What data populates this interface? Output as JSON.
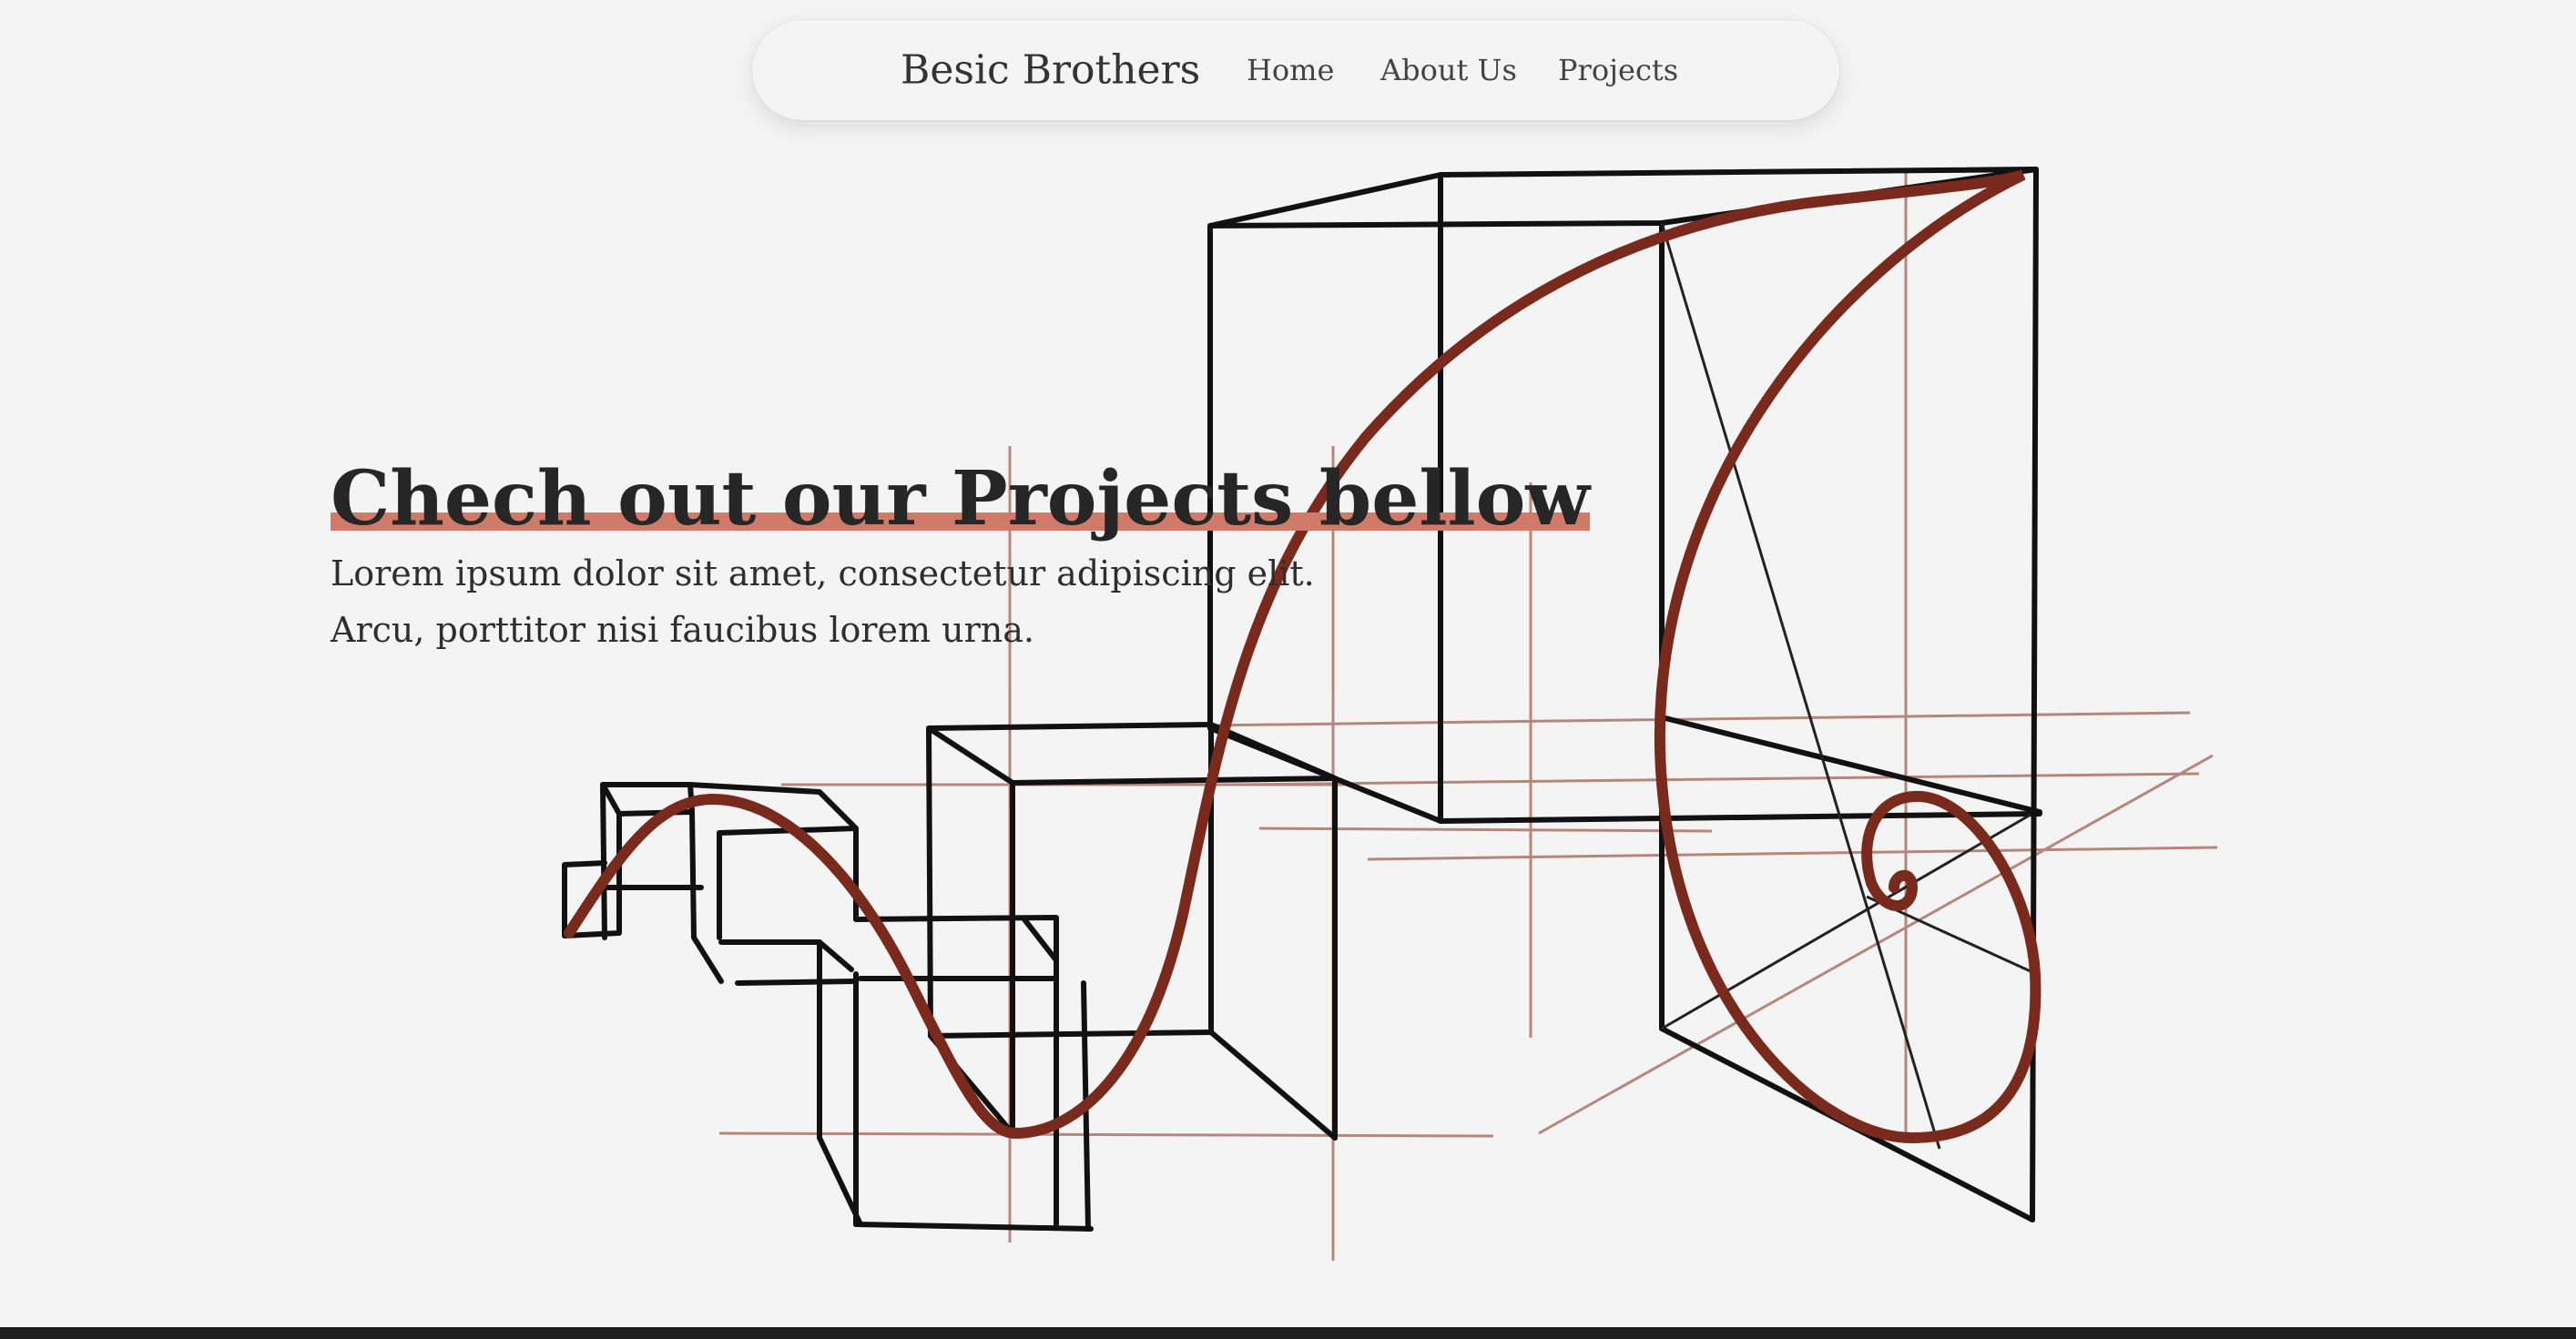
{
  "nav": {
    "brand": "Besic Brothers",
    "links": [
      "Home",
      "About Us",
      "Projects"
    ]
  },
  "hero": {
    "headline": "Chech out our Projects bellow",
    "lines": [
      "Lorem ipsum dolor sit amet, consectetur adipiscing elit.",
      "Arcu, porttitor nisi faucibus lorem urna."
    ]
  },
  "colors": {
    "background": "#f4f4f4",
    "accent": "#7a2a1c",
    "highlight": "#d17a6a",
    "footer": "#1f1f1f"
  },
  "illustration": {
    "icon": "golden-spiral-cubes-sketch"
  }
}
